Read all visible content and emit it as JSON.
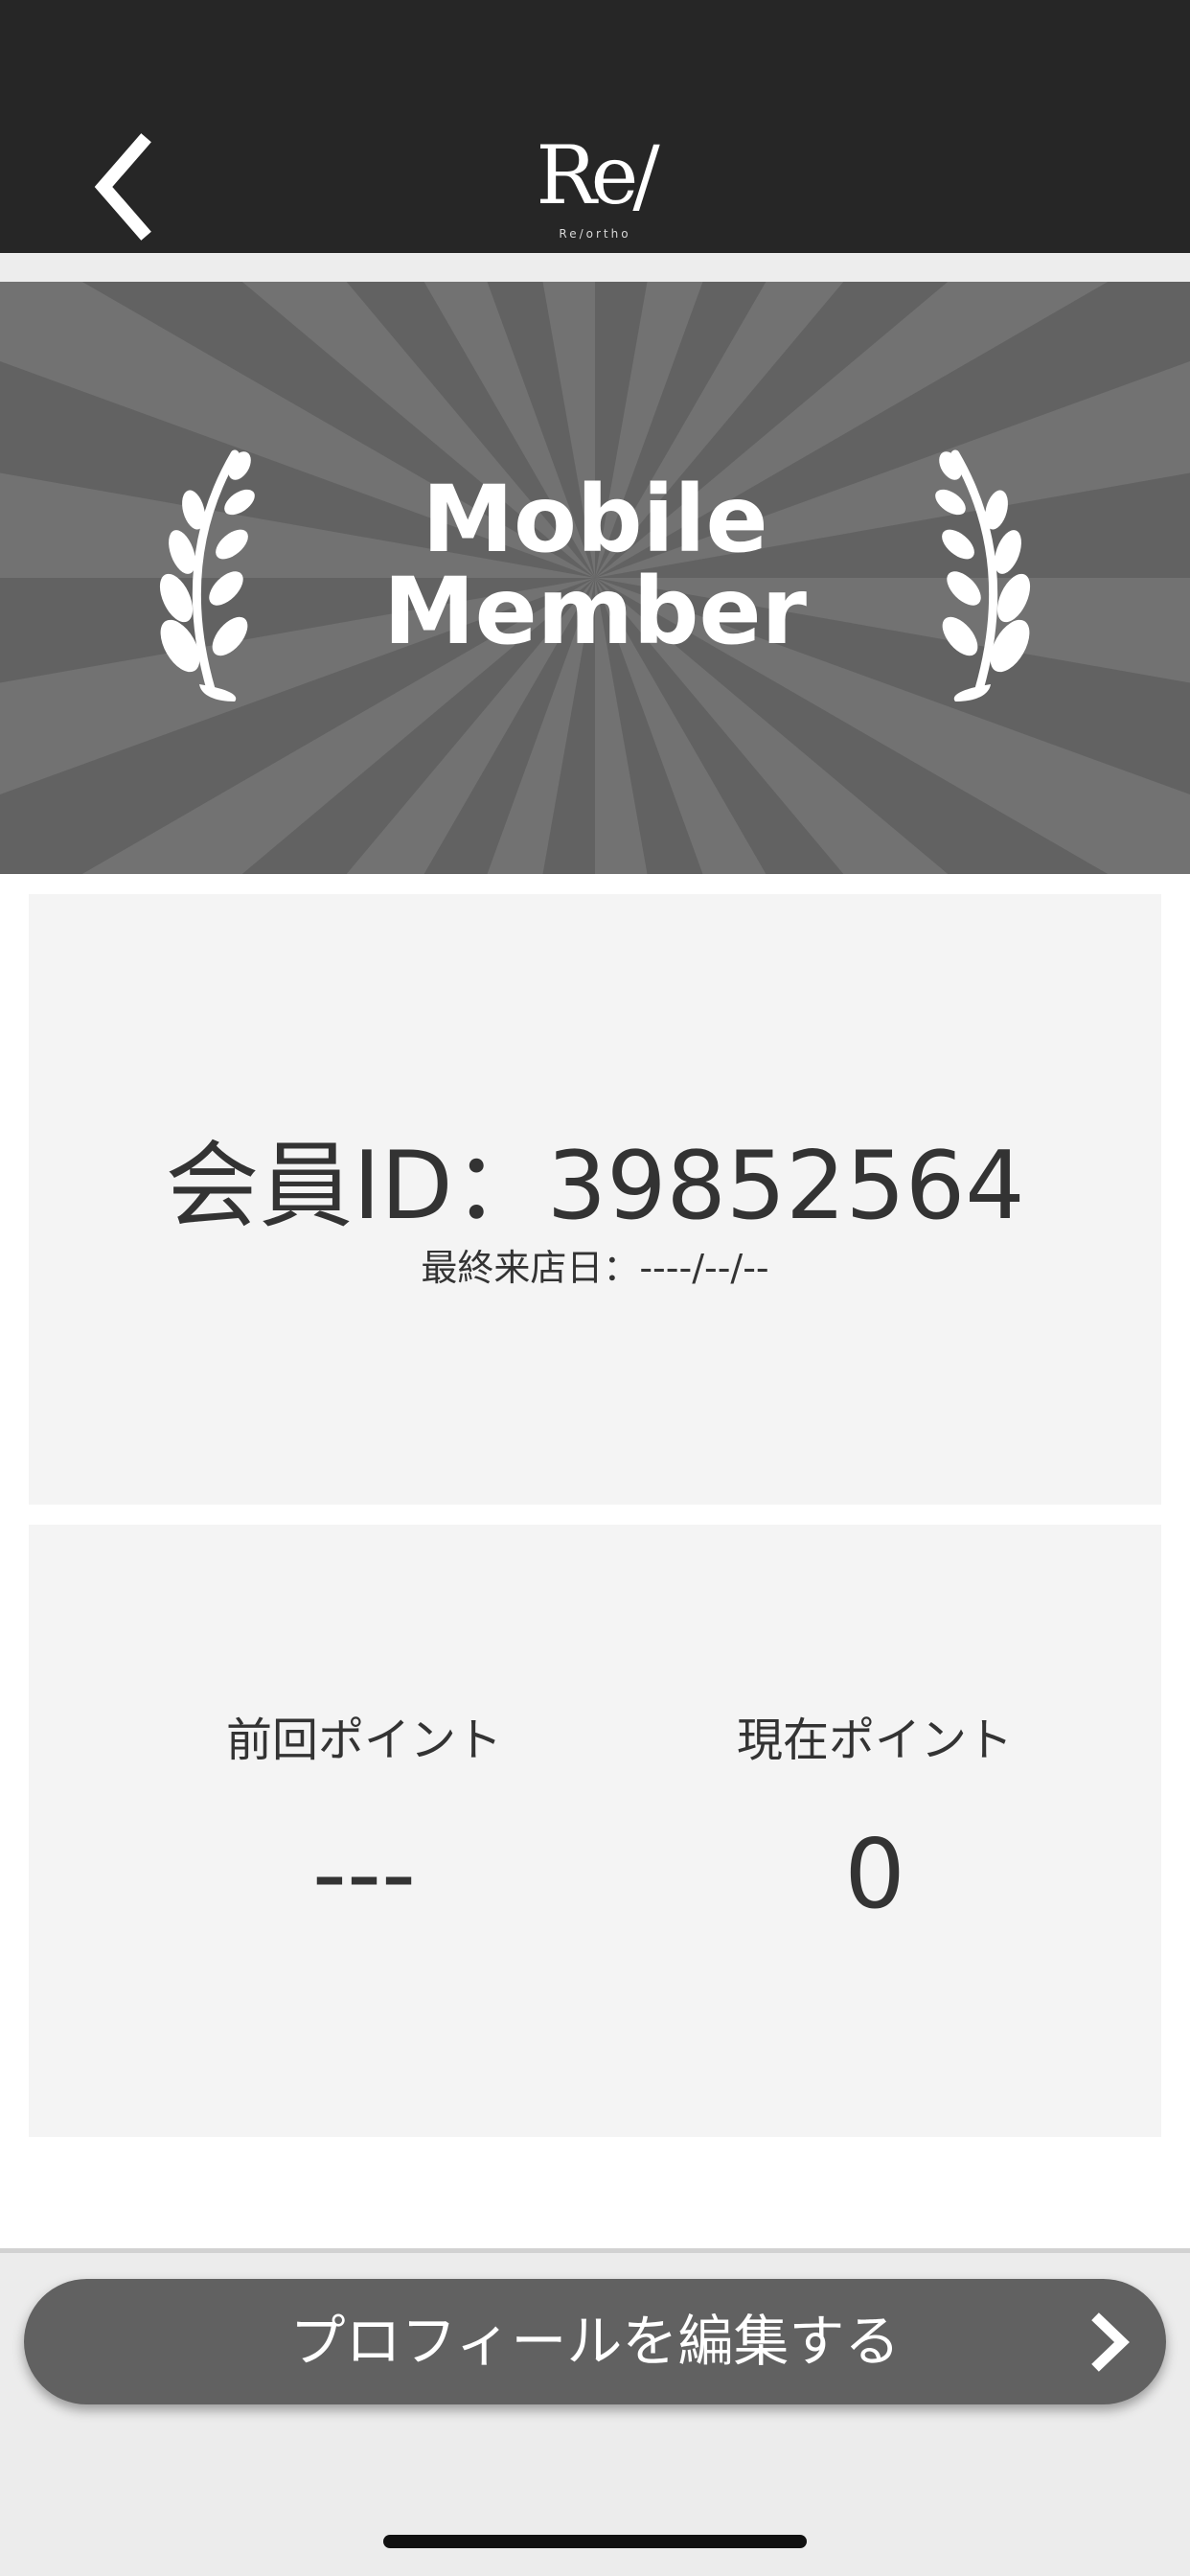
{
  "header": {
    "back_icon": "chevron-left-icon",
    "logo_mark": "Re/",
    "logo_sub": "Re/ortho"
  },
  "banner": {
    "title_line1": "Mobile",
    "title_line2": "Member",
    "icon_left": "laurel-icon",
    "icon_right": "laurel-icon"
  },
  "member": {
    "id_text": "会員ID：39852564",
    "last_visit": "最終来店日：----/--/--"
  },
  "points": {
    "previous_label": "前回ポイント",
    "previous_value": "---",
    "current_label": "現在ポイント",
    "current_value": "0"
  },
  "footer": {
    "edit_profile_label": "プロフィールを編集する",
    "chevron_icon": "chevron-right-icon"
  },
  "colors": {
    "header_bg": "#262626",
    "banner_bg": "#626262",
    "card_bg": "#f4f4f4",
    "button_bg": "#616161",
    "text": "#333333"
  }
}
